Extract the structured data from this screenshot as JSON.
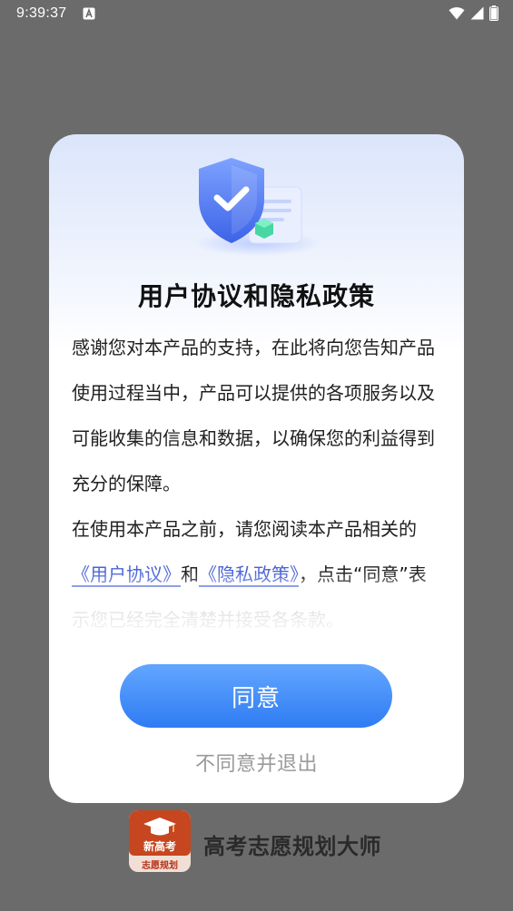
{
  "status_bar": {
    "time": "9:39:37",
    "icons": [
      "notification-a-icon",
      "wifi-icon",
      "cellular-signal-icon",
      "battery-icon"
    ]
  },
  "dialog": {
    "title": "用户协议和隐私政策",
    "paragraph1": "感谢您对本产品的支持，在此将向您告知产品使用过程当中，产品可以提供的各项服务以及可能收集的信息和数据，以确保您的利益得到充分的保障。",
    "paragraph2": {
      "prefix": "在使用本产品之前，请您阅读本产品相关的",
      "user_agreement_link": "《用户协议》",
      "conjunction": "和",
      "privacy_policy_link": "《隐私政策》",
      "suffix": "，点击“同意”表示您已经完全清楚并接受各条款。"
    },
    "agree_label": "同意",
    "decline_label": "不同意并退出"
  },
  "brand": {
    "logo_text_top": "新高考",
    "logo_text_bottom": "志愿规划",
    "name": "高考志愿规划大师"
  },
  "colors": {
    "accent": "#2e7cf3",
    "link": "#4a63d6",
    "overlay_background": "#6b6b6b",
    "decline_text": "#9a9a9a"
  }
}
